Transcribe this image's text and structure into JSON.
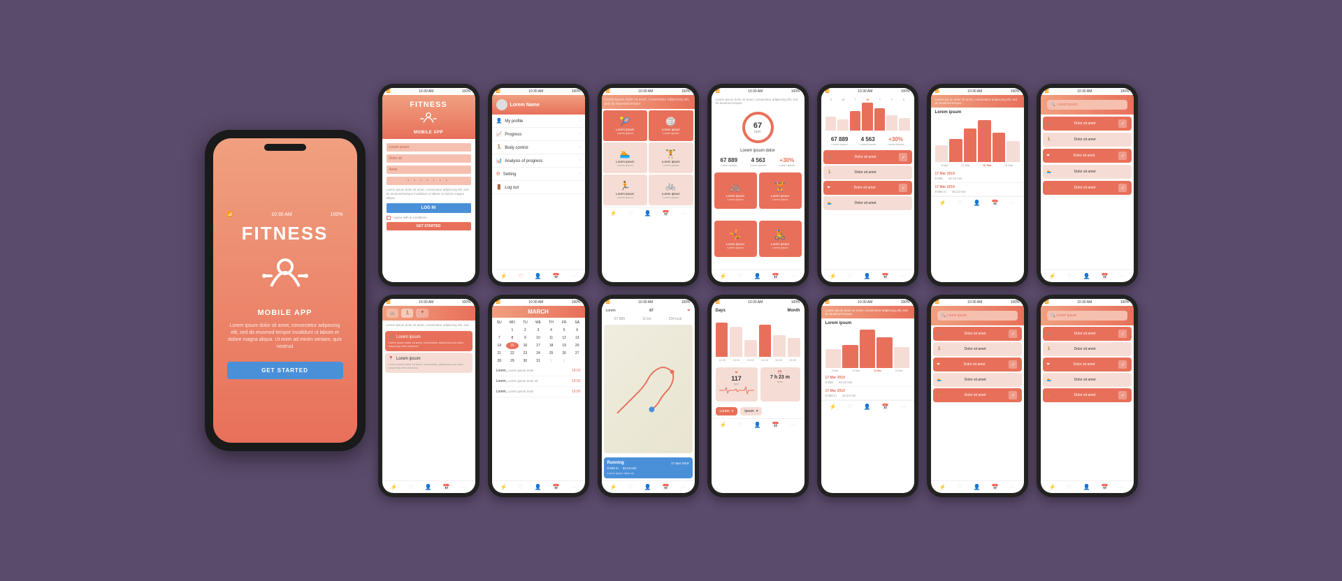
{
  "app": {
    "name": "FITNESS",
    "subtitle": "MOBILE APP",
    "desc": "Lorem ipsum dolor sit amet, consectetur adipiscing elit, sed do eiusmod tempor incididunt ut labore et dolore magna aliqua. Ut enim ad minim veniam, quis nostrud",
    "get_started": "GET STARTED",
    "time": "10:30 AM",
    "battery": "100%"
  },
  "screens": {
    "login": {
      "title": "FITNESS",
      "subtitle": "MOBILE APP",
      "fields": [
        "Lorem ipsum",
        "Dolor sit",
        "Amet",
        "Lorem ipsum"
      ],
      "login_btn": "LOG IN",
      "agree": "I agree with & conditions",
      "get_started": "GET STARTED",
      "desc": "Lorem ipsum dolor sit amet, consectetur adipiscing elit, sed do eiusmod tempor incididunt ut labore et dolore magna aliqua."
    },
    "menu": {
      "user": "Lorem Name",
      "items": [
        "My profile",
        "Progress",
        "Body control",
        "Analysis of progress",
        "Setting",
        "Log out"
      ]
    },
    "stats": {
      "steps": "67 889",
      "km": "4 563",
      "percent": "+30%"
    },
    "days_month": {
      "days": "Days",
      "month": "Month",
      "bars": [
        58,
        51,
        28,
        54,
        37,
        32
      ],
      "labels": [
        "11.02",
        "12.02",
        "13.02",
        "14.02",
        "15.02",
        "15.02"
      ]
    },
    "calendar": {
      "month": "MARCH",
      "days_header": [
        "SU",
        "MO",
        "TU",
        "WE",
        "TH",
        "FR",
        "SA"
      ],
      "days": [
        "",
        "1",
        "2",
        "3",
        "4",
        "5",
        "6",
        "7",
        "8",
        "9",
        "10",
        "11",
        "12",
        "13",
        "14",
        "15",
        "16",
        "17",
        "18",
        "19",
        "20",
        "21",
        "22",
        "23",
        "24",
        "25",
        "26",
        "27",
        "28",
        "29",
        "30",
        "31",
        "1",
        "2"
      ]
    },
    "heartrate": {
      "bpm": "67",
      "label": "bpm",
      "title": "Lorem ipsum dolor"
    },
    "running": {
      "type": "Running",
      "distance": "8 566 m",
      "date": "17 Mar 2019",
      "duration": "44:13 min",
      "desc": "Lorem ipsum dolor sit"
    },
    "stats2": {
      "steps": "9 565",
      "date": "17 Mar 2019",
      "duration": "44:13 min",
      "steps2": "8 586 m",
      "date2": "17 Mar 2019",
      "duration2": "44:13 min"
    },
    "activity_items": [
      "Dolor sit amet",
      "Dolor sit amet",
      "Dolor sit amet",
      "Dolor sit amet"
    ],
    "bpm": "117",
    "time_val": "7 h 23 m"
  },
  "colors": {
    "orange": "#e8705a",
    "light_orange": "#f0a080",
    "peach": "#f5ddd5",
    "blue": "#4a90d9",
    "bg": "#5a4a6b",
    "white": "#ffffff",
    "gray": "#999999"
  },
  "bottom_nav": {
    "icons": [
      "⚡",
      "♡",
      "👤",
      "📅",
      "···"
    ]
  }
}
